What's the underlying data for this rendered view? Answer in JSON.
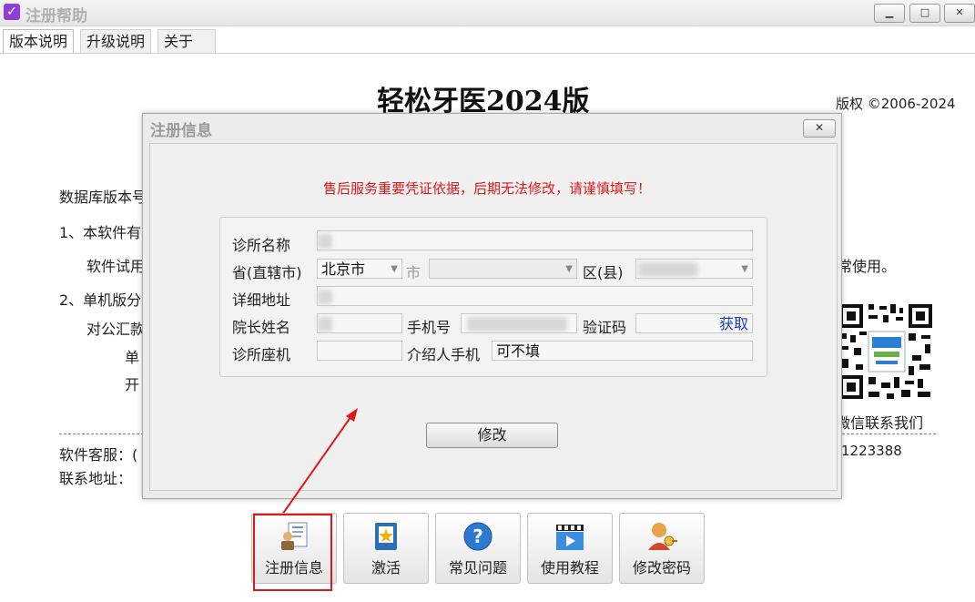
{
  "window": {
    "title": "注册帮助",
    "minimize": "▁",
    "maximize": "□",
    "close": "✕"
  },
  "tabs": [
    {
      "label": "版本说明",
      "active": true
    },
    {
      "label": "升级说明",
      "active": false
    },
    {
      "label": "关于",
      "active": false
    }
  ],
  "main": {
    "heading": "轻松牙医2024版",
    "copyright": "版权 ©2006-2024",
    "lines": {
      "db_version": "数据库版本号",
      "item1": "1、本软件有",
      "trial": "软件试用",
      "normal_use": "常使用。",
      "item2": "2、单机版分",
      "public": "对公汇款",
      "single": "单",
      "open": "开",
      "support": "软件客服：(",
      "address": "联系地址：",
      "phone_tail": "1223388",
      "wechat": "微信联系我们"
    }
  },
  "dialog": {
    "title": "注册信息",
    "close": "✕",
    "warning": "售后服务重要凭证依据，后期无法修改，请谨慎填写！",
    "fields": {
      "clinic_name_label": "诊所名称",
      "province_label": "省(直辖市)",
      "province_value": "北京市",
      "city_label": "市",
      "city_value": "",
      "district_label": "区(县)",
      "address_label": "详细地址",
      "director_label": "院长姓名",
      "mobile_label": "手机号",
      "code_label": "验证码",
      "get_code": "获取",
      "landline_label": "诊所座机",
      "referrer_label": "介绍人手机",
      "referrer_placeholder": "可不填"
    },
    "submit": "修改"
  },
  "toolbar": [
    {
      "label": "注册信息",
      "icon": "register-info-icon"
    },
    {
      "label": "激活",
      "icon": "activate-icon"
    },
    {
      "label": "常见问题",
      "icon": "faq-icon"
    },
    {
      "label": "使用教程",
      "icon": "tutorial-icon"
    },
    {
      "label": "修改密码",
      "icon": "change-password-icon"
    }
  ],
  "colors": {
    "warning": "#e01818",
    "highlight": "#e01818",
    "link": "#1a3fbf"
  }
}
